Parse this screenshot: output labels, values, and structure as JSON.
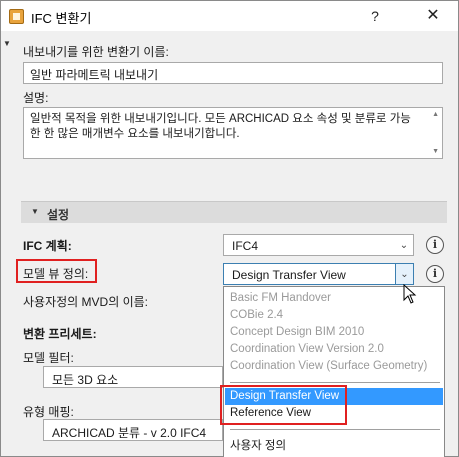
{
  "window": {
    "title": "IFC 변환기",
    "help": "?",
    "close": "✕"
  },
  "fields": {
    "name_label": "내보내기를 위한 변환기 이름:",
    "name_value": "일반 파라메트릭 내보내기",
    "desc_label": "설명:",
    "desc_value": "일반적 목적을 위한 내보내기입니다. 모든 ARCHICAD 요소 속성 및 분류로 가능한 한 많은 매개변수 요소를 내보내기합니다."
  },
  "section": {
    "title": "설정"
  },
  "settings": {
    "ifc_scheme_label": "IFC 계획:",
    "ifc_scheme_value": "IFC4",
    "model_view_label": "모델 뷰 정의:",
    "model_view_value": "Design Transfer View",
    "custom_mvd_label": "사용자정의 MVD의 이름:",
    "conversion_label": "변환 프리세트:",
    "model_filter_label": "모델 필터:",
    "model_filter_value": "모든 3D 요소",
    "type_mapping_label": "유형 매핑:",
    "type_mapping_value": "ARCHICAD 분류 - v 2.0 IFC4"
  },
  "dropdown": {
    "disabled_items": [
      "Basic FM Handover",
      "COBie 2.4",
      "Concept Design BIM 2010",
      "Coordination View Version 2.0",
      "Coordination View (Surface Geometry)"
    ],
    "enabled_items": [
      "Design Transfer View",
      "Reference View"
    ],
    "selected": "Design Transfer View",
    "custom_item": "사용자 정의"
  },
  "colors": {
    "highlight": "#3399ff",
    "annotation": "#e02020",
    "disabled_text": "#9a9a9a"
  },
  "icons": {
    "info": "i",
    "dropdown_arrow": "▾"
  }
}
